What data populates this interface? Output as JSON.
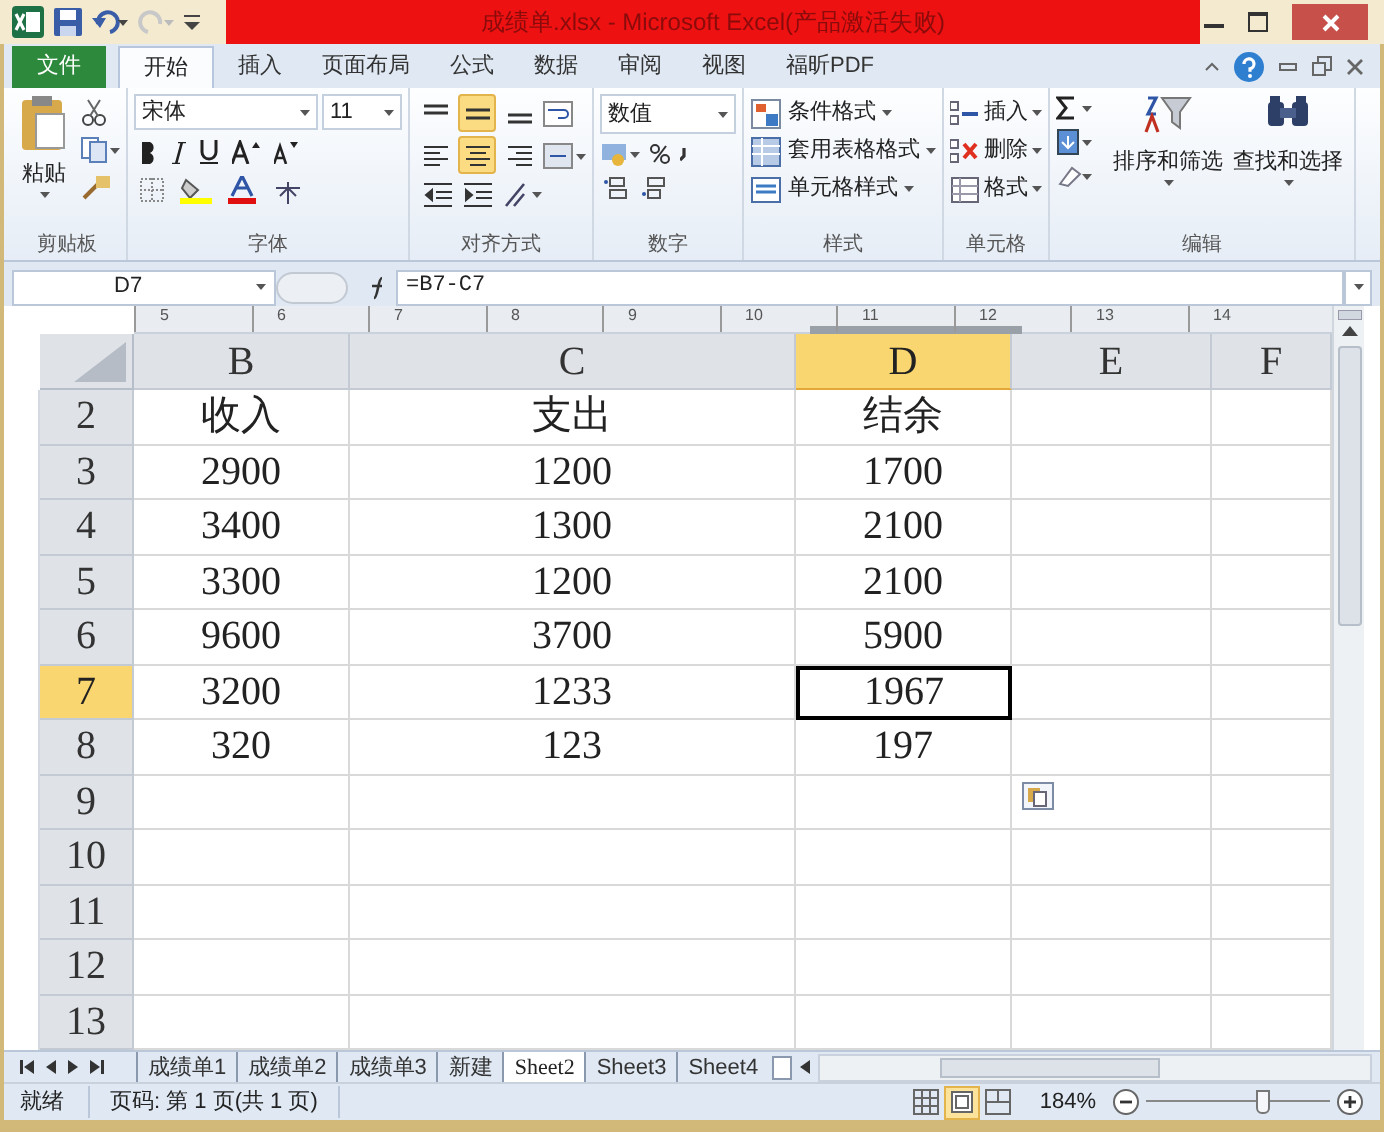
{
  "window": {
    "title": "成绩单.xlsx - Microsoft Excel(产品激活失败)"
  },
  "ribbon_tabs": [
    {
      "label": "文件",
      "kind": "file",
      "selected": false
    },
    {
      "label": "开始",
      "kind": "tab",
      "selected": true
    },
    {
      "label": "插入",
      "kind": "tab",
      "selected": false
    },
    {
      "label": "页面布局",
      "kind": "tab",
      "selected": false
    },
    {
      "label": "公式",
      "kind": "tab",
      "selected": false
    },
    {
      "label": "数据",
      "kind": "tab",
      "selected": false
    },
    {
      "label": "审阅",
      "kind": "tab",
      "selected": false
    },
    {
      "label": "视图",
      "kind": "tab",
      "selected": false
    },
    {
      "label": "福昕PDF",
      "kind": "tab",
      "selected": false
    }
  ],
  "ribbon": {
    "clipboard": {
      "paste": "粘贴",
      "label": "剪贴板"
    },
    "font": {
      "font_name": "宋体",
      "font_size": "11",
      "label": "字体"
    },
    "alignment": {
      "buttons": [
        {
          "kind": "top",
          "selected": false
        },
        {
          "kind": "middle",
          "selected": true
        },
        {
          "kind": "bottom",
          "selected": false
        },
        {
          "kind": "left",
          "selected": false
        },
        {
          "kind": "center",
          "selected": true
        },
        {
          "kind": "right",
          "selected": false
        }
      ],
      "label": "对齐方式"
    },
    "number": {
      "format": "数值",
      "label": "数字"
    },
    "styles": {
      "buttons": [
        "条件格式",
        "套用表格格式",
        "单元格样式"
      ],
      "label": "样式"
    },
    "cells": {
      "buttons": [
        "插入",
        "删除",
        "格式"
      ],
      "label": "单元格"
    },
    "editing": {
      "buttons": [
        "排序和筛选",
        "查找和选择"
      ],
      "label": "编辑"
    }
  },
  "formula_bar": {
    "name_box": "D7",
    "formula": "=B7-C7"
  },
  "ruler": [
    "5",
    "6",
    "7",
    "8",
    "9",
    "10",
    "11",
    "12",
    "13",
    "14"
  ],
  "columns": [
    {
      "label": "B",
      "selected": false
    },
    {
      "label": "C",
      "selected": false
    },
    {
      "label": "D",
      "selected": true
    },
    {
      "label": "E",
      "selected": false
    },
    {
      "label": "F",
      "selected": false
    }
  ],
  "rows": [
    {
      "number": "2",
      "selected": false,
      "cells": [
        {
          "text": "收入",
          "selected": false
        },
        {
          "text": "支出",
          "selected": false
        },
        {
          "text": "结余",
          "selected": false
        }
      ]
    },
    {
      "number": "3",
      "selected": false,
      "cells": [
        {
          "text": "2900",
          "selected": false
        },
        {
          "text": "1200",
          "selected": false
        },
        {
          "text": "1700",
          "selected": false
        }
      ]
    },
    {
      "number": "4",
      "selected": false,
      "cells": [
        {
          "text": "3400",
          "selected": false
        },
        {
          "text": "1300",
          "selected": false
        },
        {
          "text": "2100",
          "selected": false
        }
      ]
    },
    {
      "number": "5",
      "selected": false,
      "cells": [
        {
          "text": "3300",
          "selected": false
        },
        {
          "text": "1200",
          "selected": false
        },
        {
          "text": "2100",
          "selected": false
        }
      ]
    },
    {
      "number": "6",
      "selected": false,
      "cells": [
        {
          "text": "9600",
          "selected": false
        },
        {
          "text": "3700",
          "selected": false
        },
        {
          "text": "5900",
          "selected": false
        }
      ]
    },
    {
      "number": "7",
      "selected": true,
      "cells": [
        {
          "text": "3200",
          "selected": false
        },
        {
          "text": "1233",
          "selected": false
        },
        {
          "text": "1967",
          "selected": true
        }
      ]
    },
    {
      "number": "8",
      "selected": false,
      "cells": [
        {
          "text": "320",
          "selected": false
        },
        {
          "text": "123",
          "selected": false
        },
        {
          "text": "197",
          "selected": false
        }
      ]
    },
    {
      "number": "9",
      "selected": false
    },
    {
      "number": "10",
      "selected": false
    },
    {
      "number": "11",
      "selected": false
    },
    {
      "number": "12",
      "selected": false
    },
    {
      "number": "13",
      "selected": false
    }
  ],
  "sheet_tabs": [
    {
      "label": "成绩单1",
      "selected": false
    },
    {
      "label": "成绩单2",
      "selected": false
    },
    {
      "label": "成绩单3",
      "selected": false
    },
    {
      "label": "新建",
      "selected": false
    },
    {
      "label": "Sheet2",
      "selected": true
    },
    {
      "label": "Sheet3",
      "selected": false
    },
    {
      "label": "Sheet4",
      "selected": false
    }
  ],
  "status_bar": {
    "status": "就绪",
    "page": "页码: 第 1 页(共 1 页)",
    "views": [
      {
        "kind": "normal",
        "selected": false
      },
      {
        "kind": "page_layout",
        "selected": true
      },
      {
        "kind": "page_break",
        "selected": false
      }
    ],
    "zoom": "184%",
    "zoom_slider": {
      "level": 0.64
    }
  }
}
